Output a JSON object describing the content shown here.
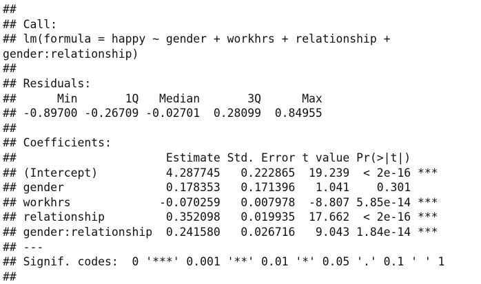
{
  "console": {
    "lines": [
      "##",
      "## Call:",
      "## lm(formula = happy ~ gender + workhrs + relationship +",
      "gender:relationship)",
      "##",
      "## Residuals:",
      "##      Min       1Q   Median       3Q      Max",
      "## -0.89700 -0.26709 -0.02701  0.28099  0.84955",
      "##",
      "## Coefficients:",
      "##                      Estimate Std. Error t value Pr(>|t|)",
      "## (Intercept)          4.287745   0.222865  19.239  < 2e-16 ***",
      "## gender               0.178353   0.171396   1.041    0.301",
      "## workhrs             -0.070259   0.007978  -8.807 5.85e-14 ***",
      "## relationship         0.352098   0.019935  17.662  < 2e-16 ***",
      "## gender:relationship  0.241580   0.026716   9.043 1.84e-14 ***",
      "## ---",
      "## Signif. codes:  0 '***' 0.001 '**' 0.01 '*' 0.05 '.' 0.1 ' ' 1",
      "##"
    ]
  }
}
